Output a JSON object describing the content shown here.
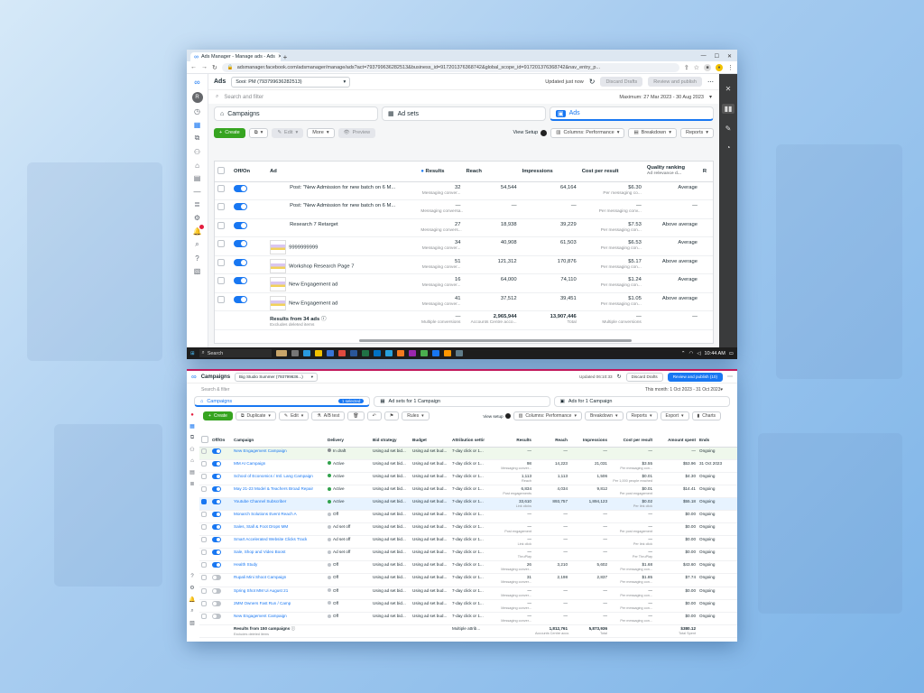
{
  "top": {
    "tab_title": "Ads Manager - Manage ads - Ads",
    "url": "adsmanager.facebook.com/adsmanager/manage/ads?act=793799636282513&business_id=917201376368742&global_scope_id=917201376368742&nav_entry_p...",
    "app_section": "Ads",
    "account": "Sooi: PM (793799636282513)",
    "updated": "Updated just now",
    "discard": "Discard Drafts",
    "review": "Review and publish",
    "search_placeholder": "Search and filter",
    "date_range": "Maximum: 27 Mar 2023 - 30 Aug 2023",
    "level_tabs": [
      "Campaigns",
      "Ad sets",
      "Ads"
    ],
    "toolbar": {
      "create": "Create",
      "edit": "Edit",
      "more": "More",
      "preview": "Preview",
      "view_setup": "View Setup",
      "columns": "Columns: Performance",
      "breakdown": "Breakdown",
      "reports": "Reports"
    },
    "headers": {
      "onoff": "Off/On",
      "ad": "Ad",
      "results": "Results",
      "reach": "Reach",
      "impressions": "Impressions",
      "cpr": "Cost per result",
      "quality": "Quality ranking",
      "quality_sub": "Ad relevance d..."
    },
    "rows": [
      {
        "on": true,
        "thumb": false,
        "name": "Post: \"New Admission for new batch on 6 M...",
        "results": "32",
        "rsub": "Messaging conver...",
        "reach": "54,544",
        "impr": "64,164",
        "cpr": "$6.30",
        "cprsub": "Per messaging co...",
        "quality": "Average"
      },
      {
        "on": true,
        "thumb": false,
        "name": "Post: \"New Admission for new batch on 6 M...",
        "results": "—",
        "rsub": "Messaging conversa...",
        "reach": "—",
        "impr": "—",
        "cpr": "—",
        "cprsub": "Per messaging conv...",
        "quality": "—"
      },
      {
        "on": true,
        "thumb": false,
        "name": "Research 7 Retarget",
        "results": "27",
        "rsub": "Messaging convers...",
        "reach": "18,938",
        "impr": "39,229",
        "cpr": "$7.53",
        "cprsub": "Per messaging con...",
        "quality": "Above average"
      },
      {
        "on": true,
        "thumb": true,
        "name": "9999999999",
        "results": "34",
        "rsub": "Messaging conver...",
        "reach": "40,908",
        "impr": "61,503",
        "cpr": "$6.53",
        "cprsub": "Per messaging con...",
        "quality": "Average"
      },
      {
        "on": true,
        "thumb": true,
        "name": "Workshop Research Page 7",
        "results": "51",
        "rsub": "Messaging conver...",
        "reach": "121,312",
        "impr": "170,876",
        "cpr": "$5.17",
        "cprsub": "Per messaging con...",
        "quality": "Above average"
      },
      {
        "on": true,
        "thumb": true,
        "name": "New Engagement ad",
        "results": "16",
        "rsub": "Messaging conver...",
        "reach": "64,000",
        "impr": "74,110",
        "cpr": "$1.24",
        "cprsub": "Per messaging con...",
        "quality": "Average"
      },
      {
        "on": true,
        "thumb": true,
        "name": "New Engagement ad",
        "results": "41",
        "rsub": "Messaging conver...",
        "reach": "37,512",
        "impr": "39,451",
        "cpr": "$1.05",
        "cprsub": "Per messaging con...",
        "quality": "Above average"
      }
    ],
    "totals": {
      "name": "Results from 34 ads",
      "sub": "Excludes deleted items",
      "results": "—",
      "rsub": "Multiple conversions",
      "reach": "2,965,944",
      "reachsub": "Accounts Centre acco...",
      "impr": "13,907,446",
      "imprsub": "Total",
      "cpr": "—",
      "cprsub": "Multiple conversions",
      "quality": "—"
    },
    "taskbar": {
      "search": "Search",
      "time": "10:44 AM"
    }
  },
  "bottom": {
    "section": "Campaigns",
    "account": "Big Studio Summer (793799636...)",
    "updated": "Updated 06:10:33",
    "discard": "Discard Drafts",
    "review": "Review and publish (10)",
    "search": "Search & filter",
    "date_range": "This month: 1 Oct 2023 - 31 Oct 2023",
    "tabs": [
      "Campaigns",
      "Ad sets for 1 Campaign",
      "Ads for 1 Campaign"
    ],
    "selected_badge": "1 selected",
    "toolbar": {
      "create": "Create",
      "duplicate": "Duplicate",
      "edit": "Edit",
      "ab": "A/B test",
      "rules": "Rules",
      "view_setup": "View setup",
      "columns": "Columns: Performance",
      "breakdown": "Breakdown",
      "reports": "Reports",
      "export": "Export",
      "charts": "Charts"
    },
    "headers": [
      "Off/On",
      "Campaign",
      "Delivery",
      "Bid strategy",
      "Budget",
      "Attribution setting",
      "Results",
      "Reach",
      "Impressions",
      "Cost per result",
      "Amount spent",
      "Ends"
    ],
    "rows": [
      {
        "on": true,
        "name": "New Engagement Campaign",
        "delivery": "In draft",
        "dc": "#8a8d91",
        "bid": "Using ad set bid...",
        "budget": "Using ad set bud...",
        "attr": "7-day click or 1...",
        "results": "—",
        "rsub": "",
        "reach": "—",
        "impr": "—",
        "cpr": "—",
        "cprsub": "",
        "spent": "—",
        "ends": "Ongoing"
      },
      {
        "on": true,
        "name": "MM AI Campaign",
        "delivery": "Active",
        "dc": "#31a24c",
        "bid": "Using ad set bid...",
        "budget": "Using ad set bud...",
        "attr": "7-day click or 1...",
        "results": "98",
        "rsub": "Messaging conver...",
        "reach": "14,223",
        "impr": "21,031",
        "cpr": "$3.55",
        "cprsub": "Per messaging con...",
        "spent": "$53.96",
        "ends": "31 Oct 2023"
      },
      {
        "on": true,
        "name": "School of Economics / Intl. Lang Campaign",
        "delivery": "Active",
        "dc": "#31a24c",
        "bid": "Using ad set bid...",
        "budget": "Using ad set bud...",
        "attr": "7-day click or 1...",
        "results": "1,113",
        "rsub": "Reach",
        "reach": "1,113",
        "impr": "1,506",
        "cpr": "$0.01",
        "cprsub": "Per 1,000 people reached",
        "spent": "$4.30",
        "ends": "Ongoing"
      },
      {
        "on": true,
        "name": "May 21-23 Model & Teachers Broad Repair",
        "delivery": "Active",
        "dc": "#31a24c",
        "bid": "Using ad set bid...",
        "budget": "Using ad set bud...",
        "attr": "7-day click or 1...",
        "results": "6,834",
        "rsub": "Post engagements",
        "reach": "4,034",
        "impr": "9,812",
        "cpr": "$0.01",
        "cprsub": "Per post engagement",
        "spent": "$14.41",
        "ends": "Ongoing"
      },
      {
        "on": true,
        "name": "Youtube Channel Subscriber",
        "delivery": "Active",
        "dc": "#31a24c",
        "bid": "Using ad set bid...",
        "budget": "Using ad set bud...",
        "attr": "7-day click or 1...",
        "results": "33,610",
        "rsub": "Link clicks",
        "reach": "893,757",
        "impr": "1,894,123",
        "cpr": "$0.02",
        "cprsub": "Per link click",
        "spent": "$55.18",
        "ends": "Ongoing",
        "hl": true
      },
      {
        "on": true,
        "name": "Monarch Solutions Event Reach A",
        "delivery": "Off",
        "dc": "#bec3c9",
        "bid": "Using ad set bid...",
        "budget": "Using ad set bud...",
        "attr": "7-day click or 1...",
        "results": "—",
        "rsub": "",
        "reach": "—",
        "impr": "—",
        "cpr": "—",
        "cprsub": "",
        "spent": "$0.00",
        "ends": "Ongoing"
      },
      {
        "on": true,
        "name": "Sales, Stall & Foot Drops MM",
        "delivery": "Ad set off",
        "dc": "#bec3c9",
        "bid": "Using ad set bid...",
        "budget": "Using ad set bud...",
        "attr": "7-day click or 1...",
        "results": "—",
        "rsub": "Post engagement",
        "reach": "—",
        "impr": "—",
        "cpr": "—",
        "cprsub": "Per post engagement",
        "spent": "$0.00",
        "ends": "Ongoing"
      },
      {
        "on": true,
        "name": "Smart Accelerated Website Clicks Track",
        "delivery": "Ad set off",
        "dc": "#bec3c9",
        "bid": "Using ad set bid...",
        "budget": "Using ad set bud...",
        "attr": "7-day click or 1...",
        "results": "—",
        "rsub": "Link click",
        "reach": "—",
        "impr": "—",
        "cpr": "—",
        "cprsub": "Per link click",
        "spent": "$0.00",
        "ends": "Ongoing"
      },
      {
        "on": true,
        "name": "Sale, Shop and Video Boost",
        "delivery": "Ad set off",
        "dc": "#bec3c9",
        "bid": "Using ad set bid...",
        "budget": "Using ad set bud...",
        "attr": "7-day click or 1...",
        "results": "—",
        "rsub": "ThruPlay",
        "reach": "—",
        "impr": "—",
        "cpr": "—",
        "cprsub": "Per ThruPlay",
        "spent": "$0.00",
        "ends": "Ongoing"
      },
      {
        "on": true,
        "name": "Health Study",
        "delivery": "Off",
        "dc": "#bec3c9",
        "bid": "Using ad set bid...",
        "budget": "Using ad set bud...",
        "attr": "7-day click or 1...",
        "results": "26",
        "rsub": "Messaging conver...",
        "reach": "3,210",
        "impr": "5,602",
        "cpr": "$1.68",
        "cprsub": "Per messaging con...",
        "spent": "$43.60",
        "ends": "Ongoing"
      },
      {
        "on": false,
        "name": "Rupali Mini Shoot Campaign",
        "delivery": "Off",
        "dc": "#bec3c9",
        "bid": "Using ad set bid...",
        "budget": "Using ad set bud...",
        "attr": "7-day click or 1...",
        "results": "31",
        "rsub": "Messaging conver...",
        "reach": "2,198",
        "impr": "2,837",
        "cpr": "$1.85",
        "cprsub": "Per messaging con...",
        "spent": "$7.74",
        "ends": "Ongoing"
      },
      {
        "on": false,
        "name": "Spring Shot MM Ui August 21",
        "delivery": "Off",
        "dc": "#bec3c9",
        "bid": "Using ad set bid...",
        "budget": "Using ad set bud...",
        "attr": "7-day click or 1...",
        "results": "—",
        "rsub": "Messaging conver...",
        "reach": "—",
        "impr": "—",
        "cpr": "—",
        "cprsub": "Per messaging con...",
        "spent": "$0.00",
        "ends": "Ongoing"
      },
      {
        "on": false,
        "name": "2MM Owners Fast Run / Camp",
        "delivery": "Off",
        "dc": "#bec3c9",
        "bid": "Using ad set bid...",
        "budget": "Using ad set bud...",
        "attr": "7-day click or 1...",
        "results": "—",
        "rsub": "Messaging conver...",
        "reach": "—",
        "impr": "—",
        "cpr": "—",
        "cprsub": "Per messaging con...",
        "spent": "$0.00",
        "ends": "Ongoing"
      },
      {
        "on": false,
        "name": "New Engagement Campaign",
        "delivery": "Off",
        "dc": "#bec3c9",
        "bid": "Using ad set bid...",
        "budget": "Using ad set bud...",
        "attr": "7-day click or 1...",
        "results": "—",
        "rsub": "Messaging conver...",
        "reach": "—",
        "impr": "—",
        "cpr": "—",
        "cprsub": "Per messaging con...",
        "spent": "$0.00",
        "ends": "Ongoing"
      }
    ],
    "totals": {
      "name": "Results from 150 campaigns",
      "sub": "Excludes deleted items",
      "attr": "Multiple attrib...",
      "reach": "1,812,761",
      "reachsub": "Accounts Centre acco...",
      "impr": "5,873,936",
      "imprsub": "Total",
      "spent": "$380.12",
      "spentsub": "Total Spent"
    }
  }
}
